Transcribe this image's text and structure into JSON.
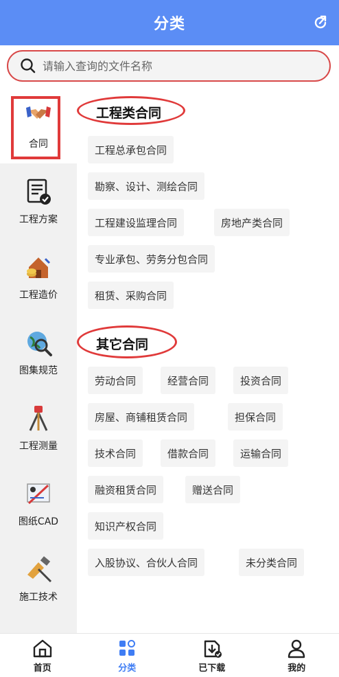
{
  "header": {
    "title": "分类"
  },
  "search": {
    "placeholder": "请输入查询的文件名称"
  },
  "sidebar": {
    "items": [
      {
        "label": "合同",
        "icon": "handshake-icon",
        "active": true
      },
      {
        "label": "工程方案",
        "icon": "document-check-icon"
      },
      {
        "label": "工程造价",
        "icon": "house-coins-icon"
      },
      {
        "label": "图集规范",
        "icon": "globe-magnifier-icon"
      },
      {
        "label": "工程测量",
        "icon": "survey-tripod-icon"
      },
      {
        "label": "图纸CAD",
        "icon": "drawing-tools-icon"
      },
      {
        "label": "施工技术",
        "icon": "construction-tools-icon"
      }
    ]
  },
  "sections": [
    {
      "title": "工程类合同",
      "tags": [
        "工程总承包合同",
        "勘察、设计、测绘合同",
        "工程建设监理合同",
        "房地产类合同",
        "专业承包、劳务分包合同",
        "租赁、采购合同"
      ]
    },
    {
      "title": "其它合同",
      "tags": [
        "劳动合同",
        "经营合同",
        "投资合同",
        "房屋、商铺租赁合同",
        "担保合同",
        "技术合同",
        "借款合同",
        "运输合同",
        "融资租赁合同",
        "赠送合同",
        "知识产权合同",
        "入股协议、合伙人合同",
        "未分类合同"
      ]
    }
  ],
  "tabbar": {
    "items": [
      {
        "label": "首页",
        "icon": "home-icon"
      },
      {
        "label": "分类",
        "icon": "category-grid-icon",
        "active": true
      },
      {
        "label": "已下载",
        "icon": "download-icon"
      },
      {
        "label": "我的",
        "icon": "profile-icon"
      }
    ]
  },
  "colors": {
    "header_bg": "#5b8df5",
    "accent": "#3f7df4",
    "highlight_red": "#e03a3a"
  }
}
